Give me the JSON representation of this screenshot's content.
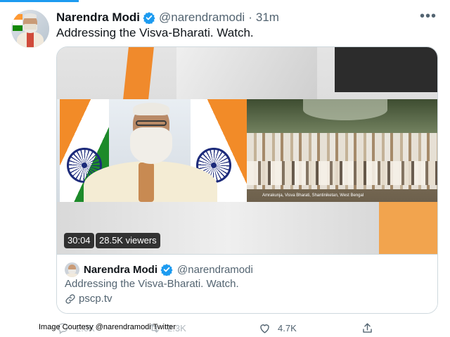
{
  "tweet": {
    "name": "Narendra Modi",
    "handle": "@narendramodi",
    "separator": "·",
    "time": "31m",
    "text": "Addressing the Visva-Bharati. Watch.",
    "more_label": "•••"
  },
  "card": {
    "video": {
      "duration": "30:04",
      "viewers": "28.5K viewers",
      "caption": "Amrakunja, Visva Bharati, Shantiniketan, West Bengal"
    },
    "author_name": "Narendra Modi",
    "author_handle": "@narendramodi",
    "text": "Addressing the Visva-Bharati. Watch.",
    "link": "pscp.tv"
  },
  "actions": {
    "reply_count": "2.0K",
    "retweet_count": "2.3K",
    "like_count": "4.7K"
  },
  "watermark": "Image Courtesy @narendramodi Twitter",
  "colors": {
    "accent": "#1d9bf0",
    "verified": "#1d9bf0",
    "text_secondary": "#536471",
    "saffron": "#f08a2c",
    "green": "#1d8a2a"
  },
  "icons": [
    "verified-badge-icon",
    "more-icon",
    "link-icon",
    "reply-icon",
    "retweet-icon",
    "like-icon",
    "share-icon"
  ]
}
